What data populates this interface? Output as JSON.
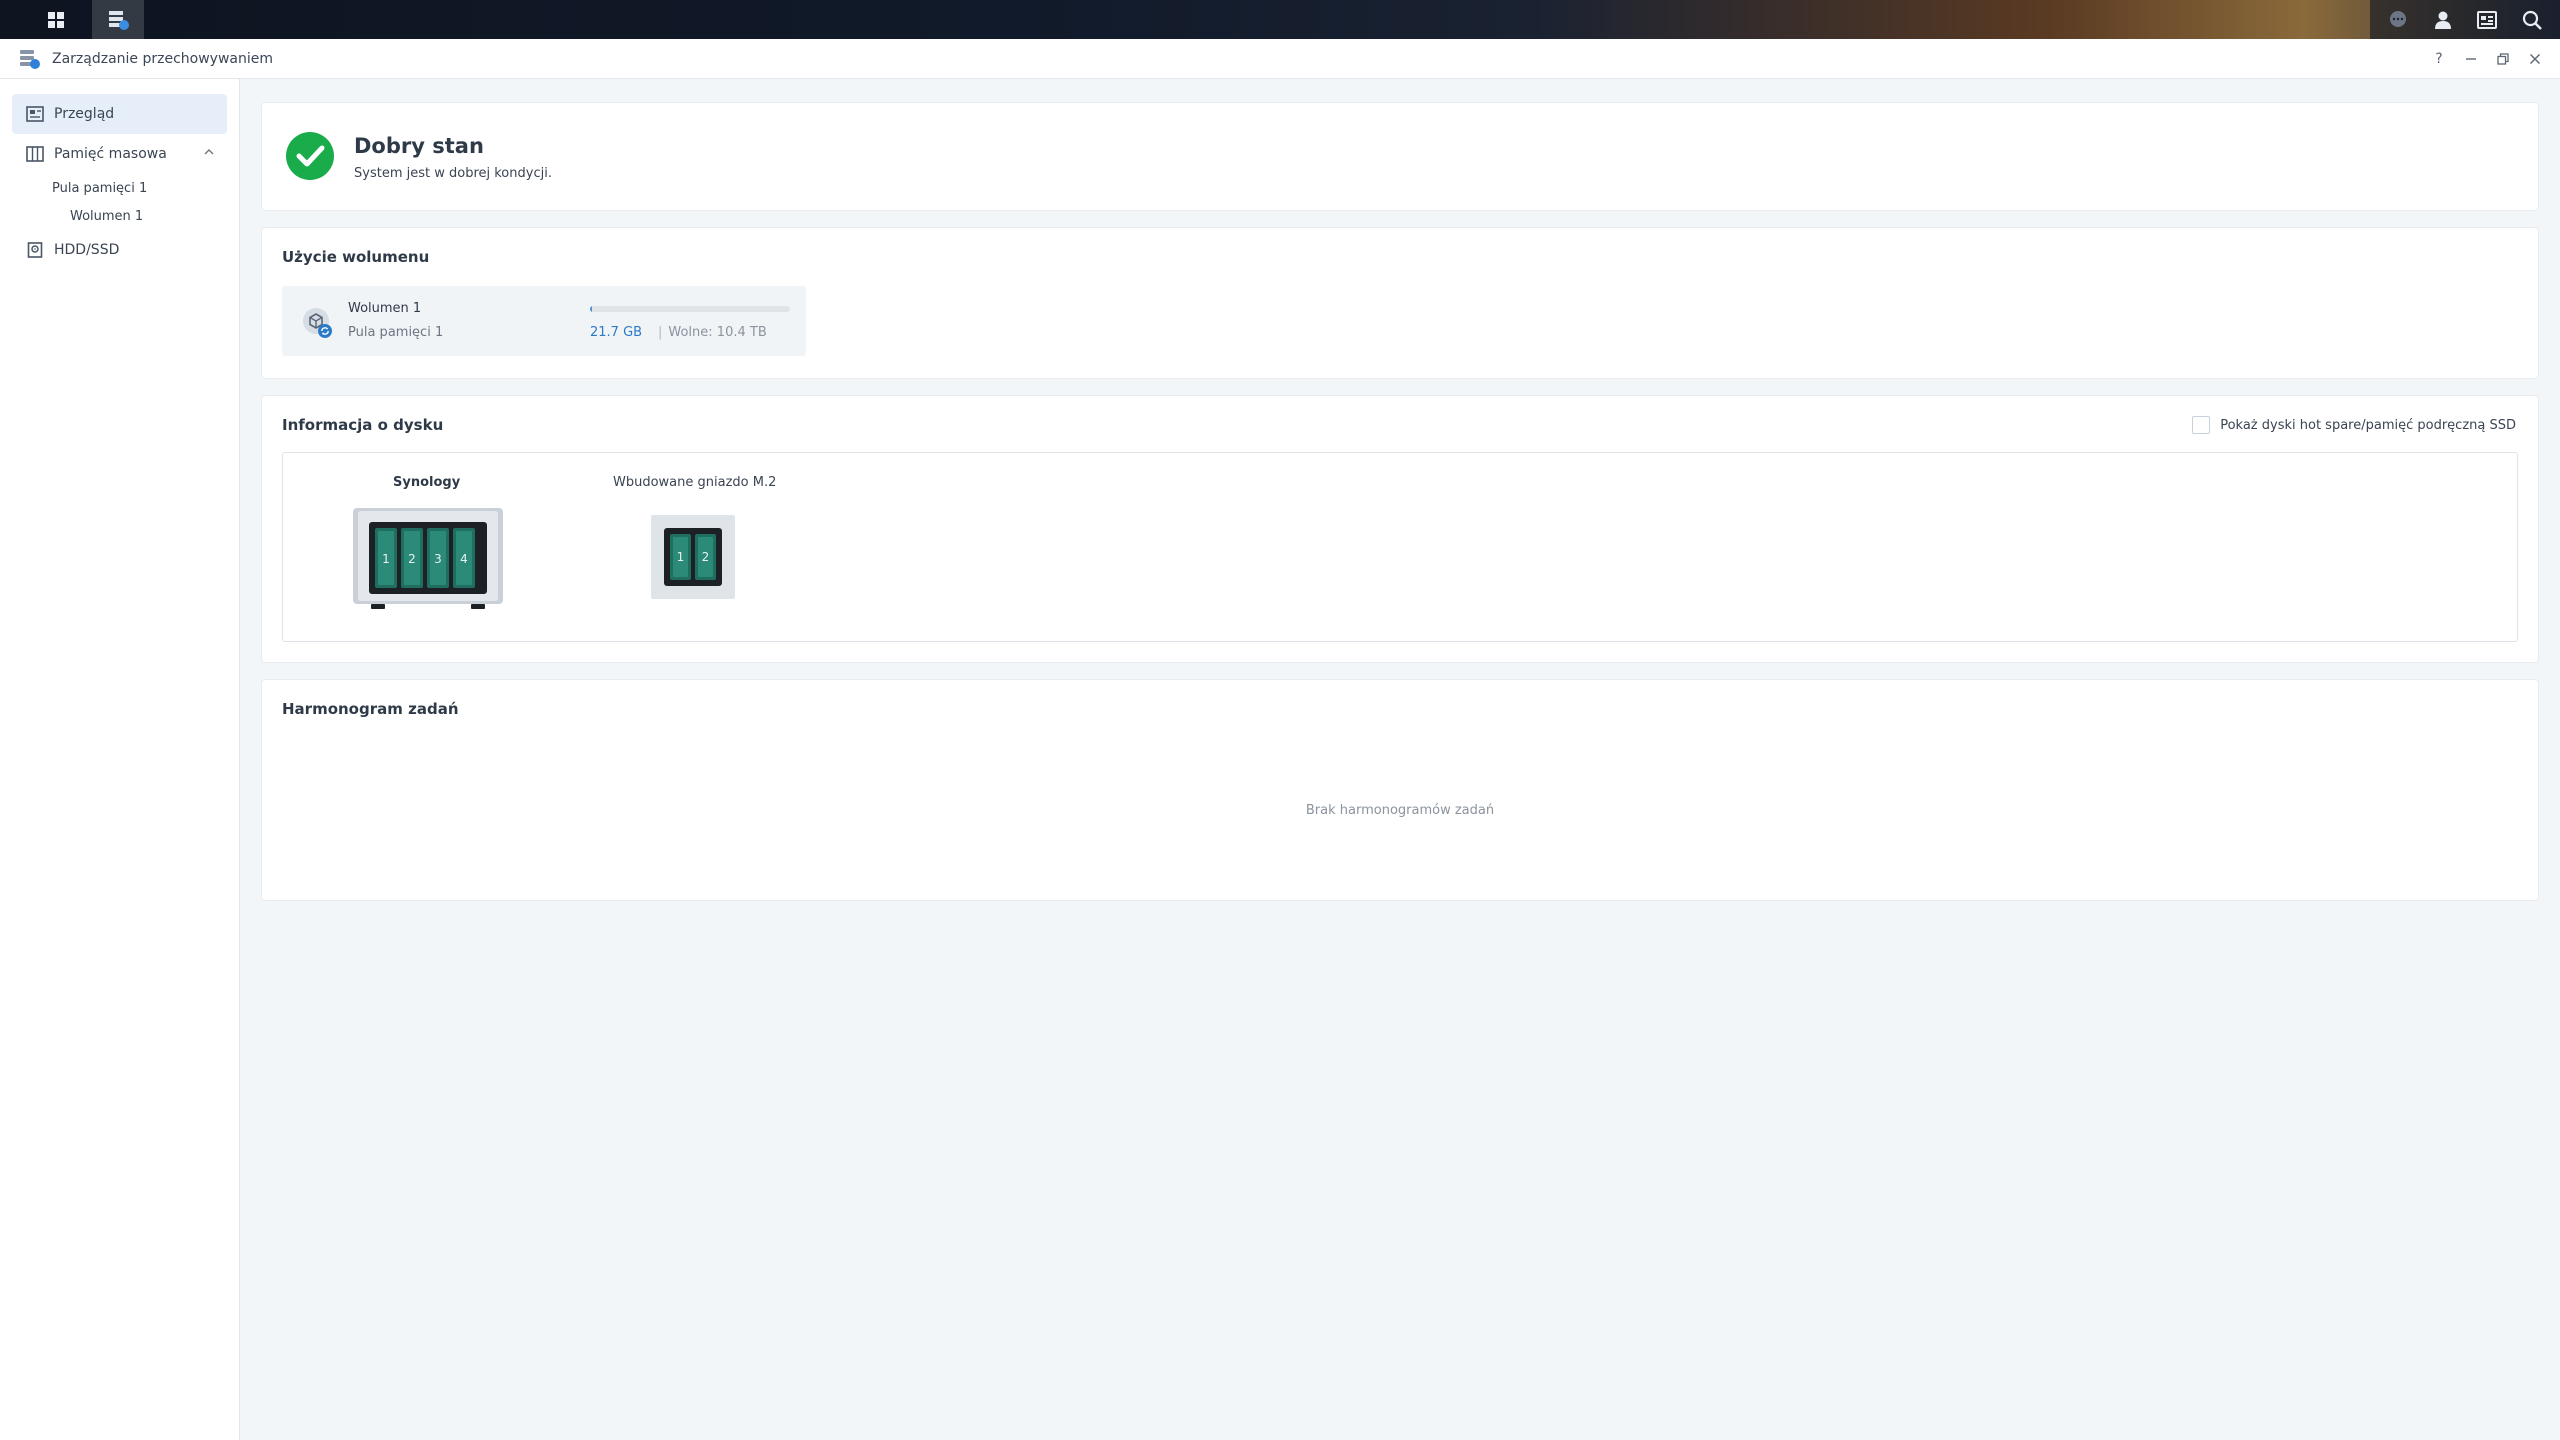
{
  "window": {
    "title": "Zarządzanie przechowywaniem"
  },
  "sidebar": {
    "overview": "Przegląd",
    "storage": "Pamięć masowa",
    "pool": "Pula pamięci 1",
    "volume": "Wolumen 1",
    "hdd": "HDD/SSD"
  },
  "status": {
    "title": "Dobry stan",
    "subtitle": "System jest w dobrej kondycji."
  },
  "volume_usage": {
    "title": "Użycie wolumenu",
    "name": "Wolumen 1",
    "pool": "Pula pamięci 1",
    "used": "21.7 GB",
    "separator": "|",
    "free": "Wolne: 10.4 TB",
    "used_fraction": 0.002
  },
  "disk_info": {
    "title": "Informacja o dysku",
    "hotspare_label": "Pokaż dyski hot spare/pamięć podręczną SSD",
    "device1": "Synology",
    "device1_bays": [
      "1",
      "2",
      "3",
      "4"
    ],
    "device2": "Wbudowane gniazdo M.2",
    "device2_slots": [
      "1",
      "2"
    ]
  },
  "schedule": {
    "title": "Harmonogram zadań",
    "empty": "Brak harmonogramów zadań"
  },
  "colors": {
    "accent": "#2b7bc9",
    "ok_green": "#1aab4a",
    "bay_green": "#1f6e60"
  }
}
